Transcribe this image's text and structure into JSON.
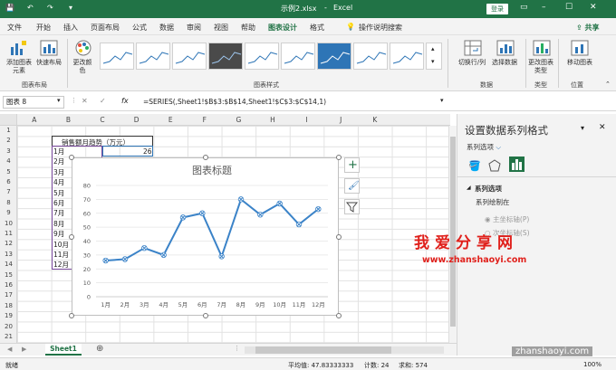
{
  "titlebar": {
    "filename": "示例2.xlsx",
    "separator": "-",
    "app": "Excel",
    "login": "登录"
  },
  "tabs": [
    "文件",
    "开始",
    "插入",
    "页面布局",
    "公式",
    "数据",
    "审阅",
    "视图",
    "帮助",
    "图表设计",
    "格式"
  ],
  "active_tab": "图表设计",
  "search_label": "操作说明搜索",
  "share_label": "共享",
  "ribbon": {
    "add_element": "添加图表元素",
    "quick_layout": "快速布局",
    "change_colors": "更改颜色",
    "group_layout": "图表布局",
    "group_styles": "图表样式",
    "switch_rowcol": "切换行/列",
    "select_data": "选择数据",
    "group_data": "数据",
    "change_type": "更改图表类型",
    "group_type": "类型",
    "move_chart": "移动图表",
    "group_location": "位置"
  },
  "formula_bar": {
    "name_box": "图表 8",
    "fx": "fx",
    "formula": "=SERIES(,Sheet1!$B$3:$B$14,Sheet1!$C$3:$C$14,1)"
  },
  "columns": [
    "A",
    "B",
    "C",
    "D",
    "E",
    "F",
    "G",
    "H",
    "I",
    "J",
    "K"
  ],
  "rows": [
    "1",
    "2",
    "3",
    "4",
    "5",
    "6",
    "7",
    "8",
    "9",
    "10",
    "11",
    "12",
    "13",
    "14",
    "15",
    "16",
    "17",
    "18",
    "19",
    "20",
    "21"
  ],
  "table": {
    "header": "销售额月趋势（万元）",
    "months": [
      "1月",
      "2月",
      "3月",
      "4月",
      "5月",
      "6月",
      "7月",
      "8月",
      "9月",
      "10月",
      "11月",
      "12月"
    ],
    "first_value": "26"
  },
  "chart_data": {
    "type": "line",
    "title": "图表标题",
    "categories": [
      "1月",
      "2月",
      "3月",
      "4月",
      "5月",
      "6月",
      "7月",
      "8月",
      "9月",
      "10月",
      "11月",
      "12月"
    ],
    "values": [
      26,
      27,
      35,
      30,
      57,
      60,
      29,
      70,
      59,
      67,
      52,
      63
    ],
    "yticks": [
      "0",
      "10",
      "20",
      "30",
      "40",
      "50",
      "60",
      "70",
      "80"
    ],
    "ylim": [
      0,
      80
    ],
    "grid": true,
    "color": "#3b83c8"
  },
  "pane": {
    "title": "设置数据系列格式",
    "series_options": "系列选项",
    "section": "系列选项",
    "plot_on": "系列绘制在",
    "primary_axis": "主坐标轴(P)",
    "secondary_axis": "次坐标轴(S)"
  },
  "sheet_tab": "Sheet1",
  "status": {
    "ready": "就绪",
    "average": "平均值: 47.83333333",
    "count": "计数: 24",
    "sum": "求和: 574",
    "zoom": "100%"
  },
  "watermark": {
    "line1": "我爱分享网",
    "line2": "www.zhanshaoyi.com",
    "line3": "zhanshaoyi.com"
  },
  "colors": {
    "brand": "#217346",
    "series": "#3b83c8",
    "watermark": "#e0201b"
  }
}
